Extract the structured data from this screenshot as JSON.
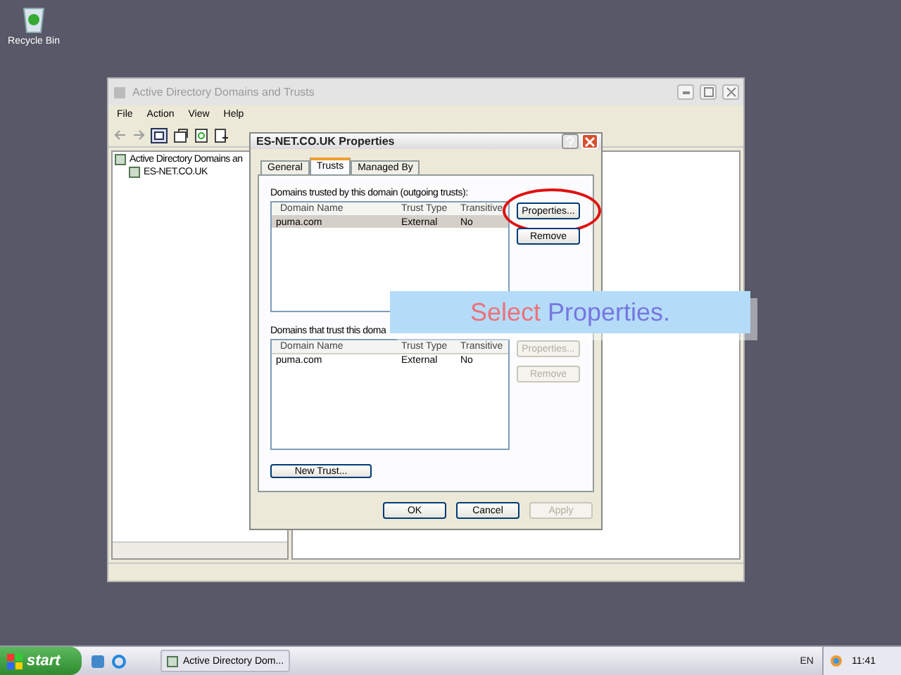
{
  "desktop": {
    "icons": [
      {
        "label": "Recycle Bin"
      }
    ]
  },
  "main_window": {
    "title": "Active Directory Domains and Trusts",
    "menu": [
      "File",
      "Action",
      "View",
      "Help"
    ],
    "tree": [
      {
        "label": "Active Directory Domains an",
        "children": [
          {
            "label": "ES-NET.CO.UK"
          }
        ]
      }
    ]
  },
  "dialog": {
    "title": "ES-NET.CO.UK Properties",
    "tabs": [
      {
        "label": "General",
        "selected": false
      },
      {
        "label": "Trusts",
        "selected": true
      },
      {
        "label": "Managed By",
        "selected": false
      }
    ],
    "sections": [
      {
        "label": "Domains trusted by this domain (outgoing trusts):",
        "columns": [
          "Domain Name",
          "Trust Type",
          "Transitive"
        ],
        "rows": [
          {
            "cells": [
              "puma.com",
              "External",
              "No"
            ],
            "selected": true
          }
        ],
        "buttons": [
          {
            "label": "Properties...",
            "disabled": false,
            "circled": true
          },
          {
            "label": "Remove",
            "disabled": false,
            "circled": false
          }
        ]
      },
      {
        "label": "Domains that trust this doma",
        "columns": [
          "Domain Name",
          "Trust Type",
          "Transitive"
        ],
        "rows": [
          {
            "cells": [
              "puma.com",
              "External",
              "No"
            ],
            "selected": false
          }
        ],
        "buttons": [
          {
            "label": "Properties...",
            "disabled": true,
            "circled": false
          },
          {
            "label": "Remove",
            "disabled": true,
            "circled": false
          }
        ]
      }
    ],
    "new_trust_button": "New Trust...",
    "buttons": [
      {
        "label": "OK",
        "disabled": false
      },
      {
        "label": "Cancel",
        "disabled": false
      },
      {
        "label": "Apply",
        "disabled": true
      }
    ]
  },
  "callout": {
    "parts": [
      {
        "text": "Select",
        "color": "#ee7078"
      },
      {
        "text": "Properties.",
        "color": "#7676e0"
      }
    ]
  },
  "taskbar": {
    "start": "start",
    "tasks": [
      {
        "label": "Active Directory Dom...",
        "selected": false
      }
    ],
    "language": "EN",
    "clock": "11:41"
  }
}
